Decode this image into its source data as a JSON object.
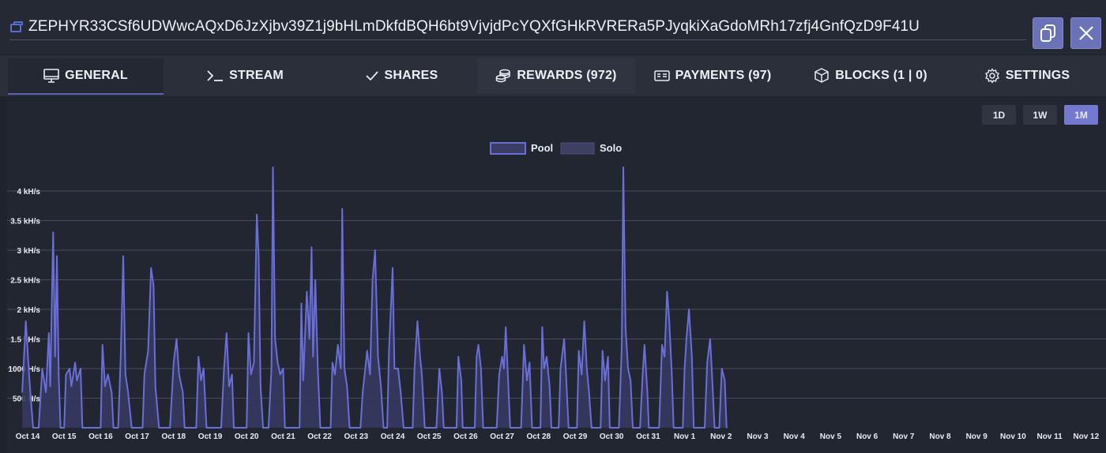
{
  "header": {
    "wallet_icon": "wallet-icon",
    "address": "ZEPHYR33CSf6UDWwcAQxD6JzXjbv39Z1j9bHLmDkfdBQH6bt9VjvjdPcYQXfGHkRVRERa5PJyqkiXaGdoMRh17zfj4GnfQzD9F41U",
    "copy_icon": "copy-icon",
    "close_icon": "close-icon"
  },
  "tabs": [
    {
      "label": "GENERAL",
      "icon": "monitor-icon",
      "active": true
    },
    {
      "label": "STREAM",
      "icon": "terminal-icon"
    },
    {
      "label": "SHARES",
      "icon": "check-icon"
    },
    {
      "label": "REWARDS (972)",
      "icon": "coins-icon"
    },
    {
      "label": "PAYMENTS (97)",
      "icon": "card-icon"
    },
    {
      "label": "BLOCKS (1 | 0)",
      "icon": "cube-icon"
    },
    {
      "label": "SETTINGS",
      "icon": "gear-icon"
    }
  ],
  "timeframes": [
    {
      "label": "1D"
    },
    {
      "label": "1W"
    },
    {
      "label": "1M",
      "active": true
    }
  ],
  "colors": {
    "accent": "#7479cf",
    "pool_line": "#6a6ed6",
    "pool_fill": "#3a3d66",
    "background": "#222630"
  },
  "chart_data": {
    "type": "area",
    "legend": [
      "Pool",
      "Solo"
    ],
    "legend_position": "top-center",
    "grid": true,
    "ylim": [
      0,
      4400
    ],
    "ytick_values": [
      500,
      1000,
      1500,
      2000,
      2500,
      3000,
      3500,
      4000
    ],
    "ytick_labels": [
      "500 H/s",
      "1000 H/s",
      "1.5 kH/s",
      "2 kH/s",
      "2.5 kH/s",
      "3 kH/s",
      "3.5 kH/s",
      "4 kH/s"
    ],
    "x_labels": [
      "Oct 14",
      "Oct 15",
      "Oct 16",
      "Oct 17",
      "Oct 18",
      "Oct 19",
      "Oct 20",
      "Oct 21",
      "Oct 22",
      "Oct 23",
      "Oct 24",
      "Oct 25",
      "Oct 26",
      "Oct 27",
      "Oct 28",
      "Oct 29",
      "Oct 30",
      "Oct 31",
      "Nov 1",
      "Nov 2",
      "Nov 3",
      "Nov 4",
      "Nov 5",
      "Nov 6",
      "Nov 7",
      "Nov 8",
      "Nov 9",
      "Nov 10",
      "Nov 11",
      "Nov 12"
    ],
    "series": [
      {
        "name": "Pool",
        "points": [
          [
            13.85,
            600
          ],
          [
            13.95,
            1800
          ],
          [
            14.05,
            800
          ],
          [
            14.15,
            0
          ],
          [
            14.3,
            0
          ],
          [
            14.4,
            1000
          ],
          [
            14.5,
            600
          ],
          [
            14.58,
            1600
          ],
          [
            14.62,
            700
          ],
          [
            14.7,
            3300
          ],
          [
            14.75,
            1200
          ],
          [
            14.8,
            2900
          ],
          [
            14.85,
            900
          ],
          [
            14.9,
            0
          ],
          [
            15.0,
            0
          ],
          [
            15.05,
            900
          ],
          [
            15.15,
            1000
          ],
          [
            15.2,
            700
          ],
          [
            15.3,
            1100
          ],
          [
            15.35,
            800
          ],
          [
            15.45,
            1000
          ],
          [
            15.5,
            0
          ],
          [
            16.0,
            0
          ],
          [
            16.05,
            1400
          ],
          [
            16.12,
            700
          ],
          [
            16.2,
            900
          ],
          [
            16.3,
            600
          ],
          [
            16.35,
            0
          ],
          [
            16.48,
            0
          ],
          [
            16.55,
            1200
          ],
          [
            16.62,
            2900
          ],
          [
            16.68,
            900
          ],
          [
            16.75,
            600
          ],
          [
            16.85,
            0
          ],
          [
            17.15,
            0
          ],
          [
            17.2,
            900
          ],
          [
            17.3,
            1300
          ],
          [
            17.38,
            2700
          ],
          [
            17.45,
            2400
          ],
          [
            17.5,
            700
          ],
          [
            17.6,
            0
          ],
          [
            17.9,
            0
          ],
          [
            18.0,
            1100
          ],
          [
            18.08,
            1500
          ],
          [
            18.15,
            900
          ],
          [
            18.25,
            600
          ],
          [
            18.3,
            0
          ],
          [
            18.62,
            0
          ],
          [
            18.68,
            1200
          ],
          [
            18.75,
            800
          ],
          [
            18.82,
            1000
          ],
          [
            18.9,
            0
          ],
          [
            19.3,
            0
          ],
          [
            19.38,
            1000
          ],
          [
            19.45,
            1600
          ],
          [
            19.52,
            700
          ],
          [
            19.6,
            900
          ],
          [
            19.65,
            0
          ],
          [
            20.0,
            0
          ],
          [
            20.05,
            1600
          ],
          [
            20.12,
            900
          ],
          [
            20.2,
            1100
          ],
          [
            20.28,
            3600
          ],
          [
            20.33,
            2900
          ],
          [
            20.38,
            700
          ],
          [
            20.45,
            0
          ],
          [
            20.6,
            0
          ],
          [
            20.68,
            1000
          ],
          [
            20.72,
            4400
          ],
          [
            20.78,
            1500
          ],
          [
            20.85,
            1100
          ],
          [
            20.92,
            900
          ],
          [
            21.0,
            1000
          ],
          [
            21.05,
            0
          ],
          [
            21.45,
            0
          ],
          [
            21.5,
            2100
          ],
          [
            21.55,
            800
          ],
          [
            21.65,
            2300
          ],
          [
            21.72,
            1500
          ],
          [
            21.78,
            3050
          ],
          [
            21.82,
            1200
          ],
          [
            21.88,
            2500
          ],
          [
            21.95,
            1000
          ],
          [
            22.02,
            0
          ],
          [
            22.3,
            0
          ],
          [
            22.35,
            1100
          ],
          [
            22.42,
            900
          ],
          [
            22.5,
            1400
          ],
          [
            22.58,
            1000
          ],
          [
            22.62,
            3700
          ],
          [
            22.68,
            1000
          ],
          [
            22.75,
            700
          ],
          [
            22.82,
            0
          ],
          [
            23.12,
            0
          ],
          [
            23.18,
            600
          ],
          [
            23.25,
            1000
          ],
          [
            23.3,
            1300
          ],
          [
            23.38,
            900
          ],
          [
            23.45,
            2500
          ],
          [
            23.52,
            3000
          ],
          [
            23.6,
            1200
          ],
          [
            23.68,
            700
          ],
          [
            23.75,
            0
          ],
          [
            23.85,
            0
          ],
          [
            23.9,
            1300
          ],
          [
            24.0,
            2700
          ],
          [
            24.05,
            1000
          ],
          [
            24.15,
            1000
          ],
          [
            24.22,
            600
          ],
          [
            24.3,
            0
          ],
          [
            24.55,
            0
          ],
          [
            24.6,
            1000
          ],
          [
            24.68,
            1800
          ],
          [
            24.75,
            1200
          ],
          [
            24.8,
            900
          ],
          [
            24.88,
            0
          ],
          [
            25.2,
            0
          ],
          [
            25.28,
            1000
          ],
          [
            25.35,
            600
          ],
          [
            25.4,
            0
          ],
          [
            25.75,
            0
          ],
          [
            25.8,
            1200
          ],
          [
            25.88,
            800
          ],
          [
            25.92,
            0
          ],
          [
            26.25,
            0
          ],
          [
            26.3,
            1200
          ],
          [
            26.35,
            1400
          ],
          [
            26.42,
            1000
          ],
          [
            26.48,
            0
          ],
          [
            26.85,
            0
          ],
          [
            26.92,
            900
          ],
          [
            27.0,
            1200
          ],
          [
            27.05,
            1000
          ],
          [
            27.1,
            1700
          ],
          [
            27.17,
            700
          ],
          [
            27.22,
            0
          ],
          [
            27.52,
            0
          ],
          [
            27.6,
            1400
          ],
          [
            27.68,
            800
          ],
          [
            27.75,
            1100
          ],
          [
            27.82,
            0
          ],
          [
            28.05,
            0
          ],
          [
            28.1,
            1700
          ],
          [
            28.15,
            1000
          ],
          [
            28.22,
            1200
          ],
          [
            28.3,
            700
          ],
          [
            28.35,
            0
          ],
          [
            28.55,
            0
          ],
          [
            28.6,
            1000
          ],
          [
            28.7,
            1500
          ],
          [
            28.75,
            900
          ],
          [
            28.82,
            0
          ],
          [
            29.05,
            0
          ],
          [
            29.1,
            1300
          ],
          [
            29.18,
            900
          ],
          [
            29.25,
            1800
          ],
          [
            29.32,
            1000
          ],
          [
            29.38,
            600
          ],
          [
            29.45,
            0
          ],
          [
            29.7,
            0
          ],
          [
            29.75,
            1300
          ],
          [
            29.82,
            800
          ],
          [
            29.9,
            1200
          ],
          [
            29.95,
            0
          ],
          [
            30.2,
            0
          ],
          [
            30.28,
            1400
          ],
          [
            30.32,
            4400
          ],
          [
            30.38,
            1700
          ],
          [
            30.45,
            1000
          ],
          [
            30.52,
            800
          ],
          [
            30.58,
            0
          ],
          [
            30.78,
            0
          ],
          [
            30.85,
            900
          ],
          [
            30.9,
            1400
          ],
          [
            30.98,
            600
          ],
          [
            31.02,
            0
          ],
          [
            31.3,
            0
          ],
          [
            31.38,
            1400
          ],
          [
            31.45,
            1200
          ],
          [
            31.52,
            2300
          ],
          [
            31.58,
            1800
          ],
          [
            31.65,
            900
          ],
          [
            31.7,
            0
          ],
          [
            31.95,
            0
          ],
          [
            32.0,
            1000
          ],
          [
            32.05,
            1500
          ],
          [
            32.12,
            2000
          ],
          [
            32.2,
            1200
          ],
          [
            32.25,
            0
          ],
          [
            32.55,
            0
          ],
          [
            32.62,
            1100
          ],
          [
            32.7,
            1500
          ],
          [
            32.75,
            900
          ],
          [
            32.82,
            0
          ],
          [
            32.95,
            0
          ],
          [
            33.02,
            1000
          ],
          [
            33.1,
            800
          ],
          [
            33.15,
            0
          ]
        ]
      },
      {
        "name": "Solo",
        "points": []
      }
    ]
  }
}
